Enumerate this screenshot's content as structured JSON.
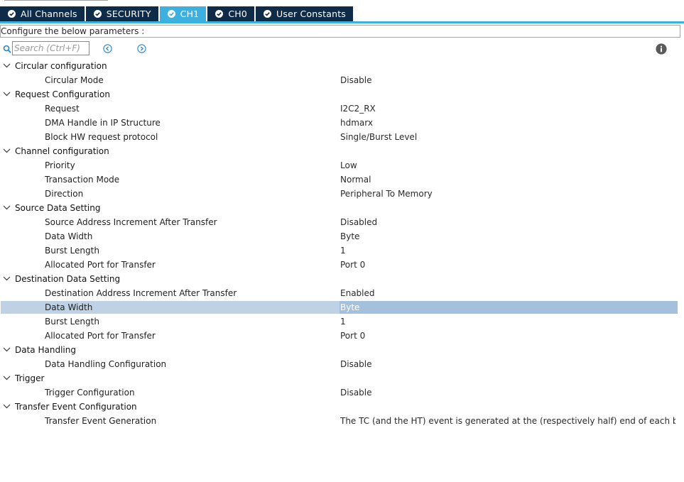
{
  "tabs": [
    {
      "label": "All Channels",
      "active": false
    },
    {
      "label": "SECURITY",
      "active": false
    },
    {
      "label": "CH1",
      "active": true
    },
    {
      "label": "CH0",
      "active": false
    },
    {
      "label": "User Constants",
      "active": false
    }
  ],
  "config_label": "Configure the below parameters :",
  "search": {
    "placeholder": "Search (Ctrl+F)",
    "value": ""
  },
  "icons": {
    "search": "search-icon",
    "prev": "circle-chevron-left-icon",
    "next": "circle-chevron-right-icon",
    "info": "info-icon",
    "expand": "chevron-down-icon",
    "tab_status": "check-circle-icon"
  },
  "colors": {
    "tab_bg": "#0e2b48",
    "tab_active_bg": "#3cb0de",
    "selection_bg": "#bed1e5",
    "accent": "#3cb0de"
  },
  "groups": [
    {
      "label": "Circular configuration",
      "params": [
        {
          "name": "Circular Mode",
          "value": "Disable"
        }
      ]
    },
    {
      "label": "Request Configuration",
      "params": [
        {
          "name": "Request",
          "value": "I2C2_RX"
        },
        {
          "name": "DMA Handle in IP Structure",
          "value": "hdmarx"
        },
        {
          "name": "Block HW request protocol",
          "value": "Single/Burst Level"
        }
      ]
    },
    {
      "label": "Channel configuration",
      "params": [
        {
          "name": "Priority",
          "value": "Low"
        },
        {
          "name": "Transaction Mode",
          "value": "Normal"
        },
        {
          "name": "Direction",
          "value": "Peripheral To Memory"
        }
      ]
    },
    {
      "label": "Source Data Setting",
      "params": [
        {
          "name": "Source Address Increment After Transfer",
          "value": "Disabled"
        },
        {
          "name": "Data Width",
          "value": "Byte"
        },
        {
          "name": "Burst Length",
          "value": "1"
        },
        {
          "name": "Allocated Port for Transfer",
          "value": "Port 0"
        }
      ]
    },
    {
      "label": "Destination Data Setting",
      "params": [
        {
          "name": "Destination Address Increment After Transfer",
          "value": "Enabled"
        },
        {
          "name": "Data Width",
          "value": "Byte",
          "selected": true
        },
        {
          "name": "Burst Length",
          "value": "1"
        },
        {
          "name": "Allocated Port for Transfer",
          "value": "Port 0"
        }
      ]
    },
    {
      "label": "Data Handling",
      "params": [
        {
          "name": "Data Handling Configuration",
          "value": "Disable"
        }
      ]
    },
    {
      "label": "Trigger",
      "params": [
        {
          "name": "Trigger Configuration",
          "value": "Disable"
        }
      ]
    },
    {
      "label": "Transfer Event Configuration",
      "params": [
        {
          "name": "Transfer Event Generation",
          "value": "The TC (and the HT) event is generated at the (respectively half) end of each blo..."
        }
      ]
    }
  ]
}
